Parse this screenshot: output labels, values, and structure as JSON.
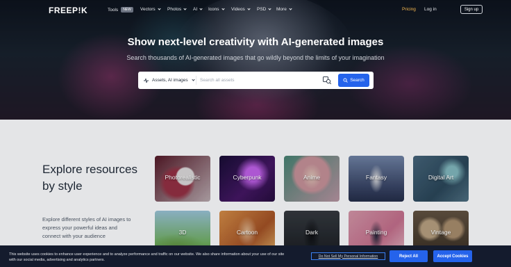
{
  "brand": {
    "logo": "FREEP!K"
  },
  "nav": {
    "items": [
      {
        "label": "Tools",
        "badge": "NEW"
      },
      {
        "label": "Vectors"
      },
      {
        "label": "Photos"
      },
      {
        "label": "AI"
      },
      {
        "label": "Icons"
      },
      {
        "label": "Videos"
      },
      {
        "label": "PSD"
      },
      {
        "label": "More"
      }
    ],
    "pricing": "Pricing",
    "login": "Log in",
    "signup": "Sign up"
  },
  "hero": {
    "title": "Show next-level creativity with AI-generated images",
    "subtitle": "Search thousands of AI-generated images that go wildly beyond the limits of your imagination"
  },
  "search": {
    "type_label": "Assets, AI images",
    "placeholder": "Search all assets",
    "button": "Search"
  },
  "explore": {
    "title": "Explore resources by style",
    "description": "Explore different styles of AI images to express your powerful ideas and connect with your audience",
    "styles": [
      {
        "label": "Photorealistic"
      },
      {
        "label": "Cyberpunk"
      },
      {
        "label": "Anime"
      },
      {
        "label": "Fantasy"
      },
      {
        "label": "Digital Art"
      },
      {
        "label": "3D"
      },
      {
        "label": "Cartoon"
      },
      {
        "label": "Dark"
      },
      {
        "label": "Painting"
      },
      {
        "label": "Vintage"
      }
    ]
  },
  "cookie": {
    "text": "This website uses cookies to enhance user experience and to analyze performance and traffic on our website. We also share information about your use of our site with our social media, advertising and analytics partners.",
    "dns_link": "Do Not Sell My Personal Information",
    "reject": "Reject All",
    "accept": "Accept Cookies"
  },
  "colors": {
    "accent": "#2563eb",
    "pricing": "#f5b74f",
    "banner": "#141b2d"
  }
}
